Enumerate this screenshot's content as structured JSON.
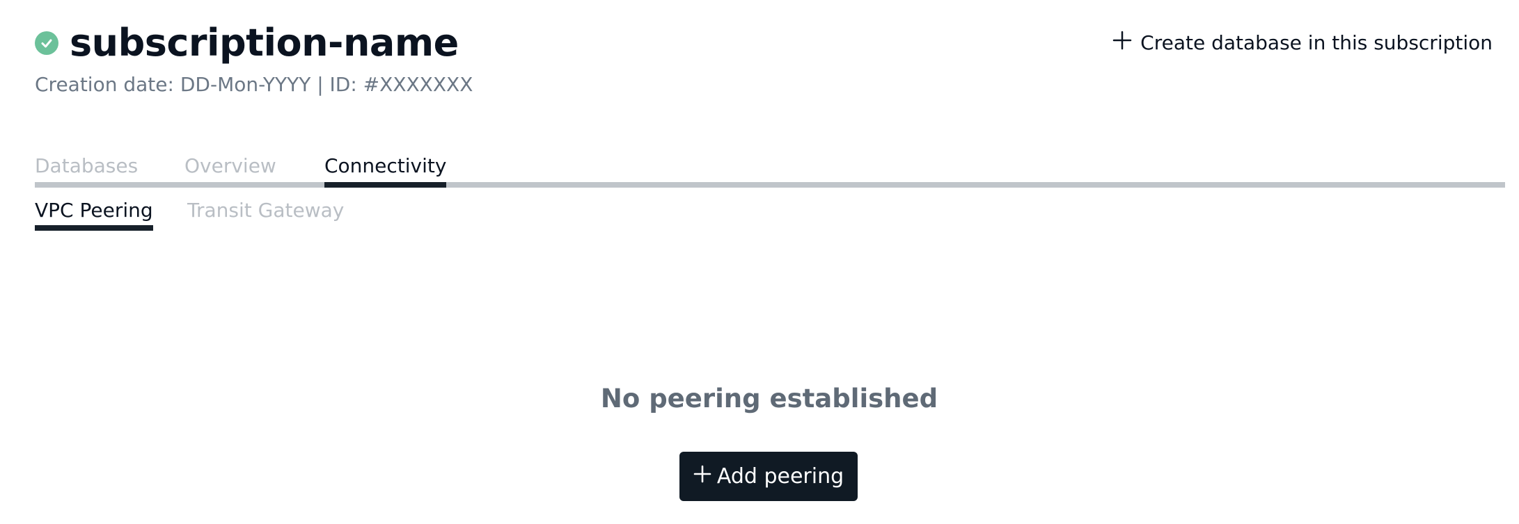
{
  "header": {
    "title": "subscription-name",
    "meta": "Creation date: DD-Mon-YYYY | ID: #XXXXXXX",
    "status_icon": "check-circle-icon",
    "status_color": "#6cc19a"
  },
  "actions": {
    "create_database": "Create database in this subscription",
    "create_icon": "plus-icon"
  },
  "tabs": [
    {
      "label": "Databases",
      "active": false
    },
    {
      "label": "Overview",
      "active": false
    },
    {
      "label": "Connectivity",
      "active": true
    }
  ],
  "subtabs": [
    {
      "label": "VPC Peering",
      "active": true
    },
    {
      "label": "Transit Gateway",
      "active": false
    }
  ],
  "empty_state": {
    "title": "No peering established",
    "button_label": "Add peering",
    "button_icon": "plus-icon"
  },
  "colors": {
    "primary_dark": "#101a24",
    "muted_text": "#5f6a76",
    "inactive_tab": "#b9bec4"
  }
}
